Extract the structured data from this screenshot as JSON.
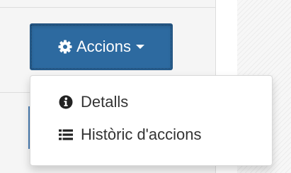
{
  "button": {
    "label": "Accions",
    "icon": "gear-icon",
    "caret_icon": "caret-down-icon",
    "color": "#2d6aa0"
  },
  "menu": {
    "items": [
      {
        "label": "Detalls",
        "icon": "info-circle-icon"
      },
      {
        "label": "Històric d'accions",
        "icon": "list-icon"
      }
    ]
  }
}
